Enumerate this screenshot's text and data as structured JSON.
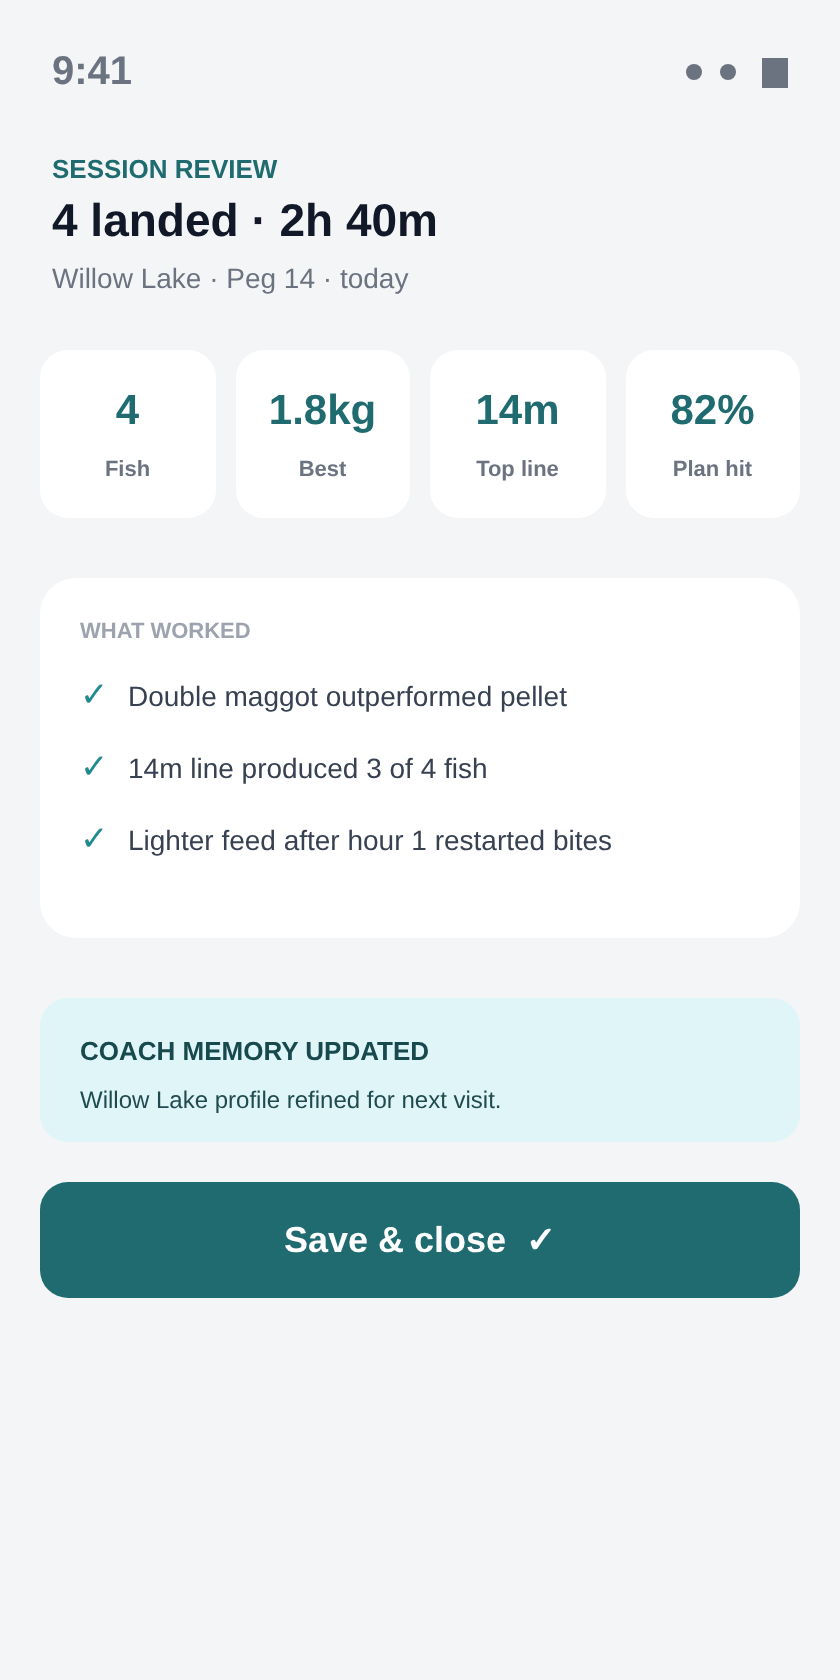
{
  "status_bar": {
    "time": "9:41"
  },
  "header": {
    "eyebrow": "SESSION REVIEW",
    "title": "4 landed · 2h 40m",
    "subtitle": "Willow Lake · Peg 14 · today"
  },
  "stats": [
    {
      "value": "4",
      "label": "Fish"
    },
    {
      "value": "1.8kg",
      "label": "Best"
    },
    {
      "value": "14m",
      "label": "Top line"
    },
    {
      "value": "82%",
      "label": "Plan hit"
    }
  ],
  "what_worked": {
    "heading": "WHAT WORKED",
    "items": [
      {
        "mark": "✓",
        "text": "Double maggot outperformed pellet"
      },
      {
        "mark": "✓",
        "text": "14m line produced 3 of 4 fish"
      },
      {
        "mark": "✓",
        "text": "Lighter feed after hour 1 restarted bites"
      }
    ]
  },
  "notice": {
    "title": "COACH MEMORY UPDATED",
    "body": "Willow Lake profile refined for next visit."
  },
  "primary_button": {
    "label": "Save & close",
    "icon": "✓"
  }
}
